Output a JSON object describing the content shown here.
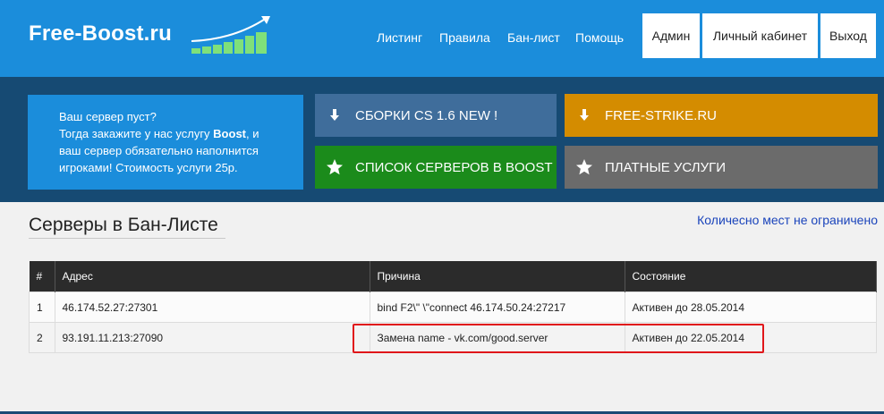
{
  "header": {
    "logo": "Free-Boost.ru",
    "nav": [
      "Листинг",
      "Правила",
      "Бан-лист",
      "Помощь"
    ],
    "buttons": [
      "Админ",
      "Личный кабинет",
      "Выход"
    ]
  },
  "promo": {
    "line1": "Ваш сервер пуст?",
    "line2_a": "Тогда закажите у нас услугу ",
    "line2_b": "Boost",
    "line2_c": ", и",
    "line3": "ваш сервер обязательно наполнится",
    "line4": "игроками! Стоимость услуги 25р."
  },
  "tiles": [
    {
      "label": "СБОРКИ CS 1.6 NEW !",
      "icon": "download-icon",
      "color": "#3f6d9b"
    },
    {
      "label": "FREE-STRIKE.RU",
      "icon": "download-icon",
      "color": "#d48c00"
    },
    {
      "label": "СПИСОК СЕРВЕРОВ В BOOST",
      "icon": "star-icon",
      "color": "#1b8b1b"
    },
    {
      "label": "ПЛАТНЫЕ УСЛУГИ",
      "icon": "star-icon",
      "color": "#6b6b6b"
    }
  ],
  "content": {
    "title": "Серверы в Бан-Листе",
    "notice": "Количесно мест не ограничено"
  },
  "table": {
    "headers": [
      "#",
      "Адрес",
      "Причина",
      "Состояние"
    ],
    "rows": [
      [
        "1",
        "46.174.52.27:27301",
        "bind F2\\\" \\\"connect 46.174.50.24:27217",
        "Активен до 28.05.2014"
      ],
      [
        "2",
        "93.191.11.213:27090",
        "Замена name - vk.com/good.server",
        "Активен до 22.05.2014"
      ]
    ]
  },
  "colors": {
    "brand": "#1b8ddb",
    "band": "#164a73",
    "highlight": "#e0161a"
  }
}
